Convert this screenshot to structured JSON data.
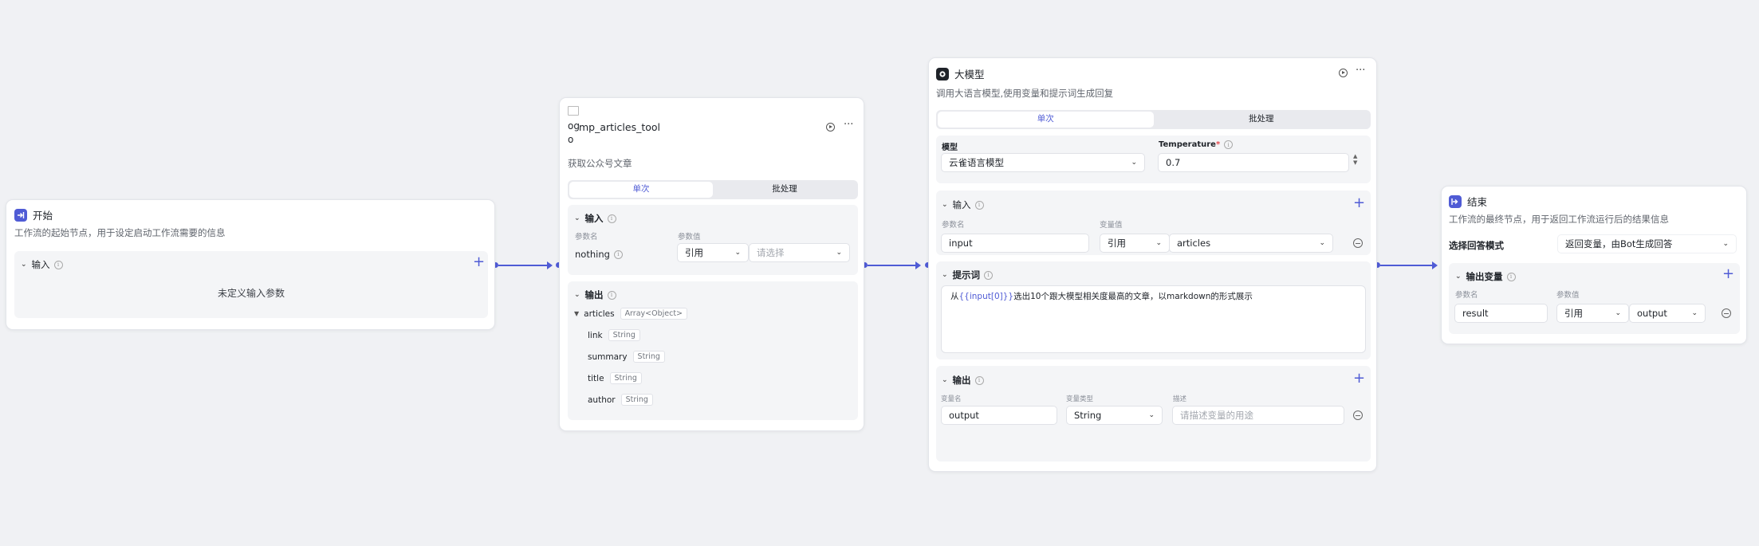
{
  "colors": {
    "accent": "#4f5bd5",
    "start_icon": "#4f5bd5",
    "llm_icon": "#1f2329",
    "end_icon": "#4f5bd5"
  },
  "start_node": {
    "title": "开始",
    "description": "工作流的起始节点，用于设定启动工作流需要的信息",
    "input_section": "输入",
    "empty_text": "未定义输入参数",
    "icon": "enter-icon"
  },
  "tool_node": {
    "broken_image_text": [
      "og",
      "o"
    ],
    "title": "mp_articles_tool",
    "description": "获取公众号文章",
    "tabs": [
      "单次",
      "批处理"
    ],
    "input_section": "输入",
    "param_name_label": "参数名",
    "param_value_label": "参数值",
    "param_name": "nothing",
    "ref_select": "引用",
    "value_placeholder": "请选择",
    "output_section": "输出",
    "outputs": [
      {
        "name": "articles",
        "type": "Array<Object>"
      },
      {
        "name": "link",
        "type": "String"
      },
      {
        "name": "summary",
        "type": "String"
      },
      {
        "name": "title",
        "type": "String"
      },
      {
        "name": "author",
        "type": "String"
      }
    ]
  },
  "llm_node": {
    "title": "大模型",
    "description": "调用大语言模型,使用变量和提示词生成回复",
    "tabs": [
      "单次",
      "批处理"
    ],
    "model_label": "模型",
    "model_value": "云雀语言模型",
    "temperature_label": "Temperature",
    "temperature_required": "*",
    "temperature_value": "0.7",
    "input_section": "输入",
    "param_name_label": "参数名",
    "var_value_label": "变量值",
    "input_name": "input",
    "ref_select": "引用",
    "ref_value": "articles",
    "prompt_section": "提示词",
    "prompt_prefix": "从",
    "prompt_var": "{{input[0]}}",
    "prompt_suffix": "选出10个跟大模型相关度最高的文章，以markdown的形式展示",
    "output_section": "输出",
    "out_name_label": "变量名",
    "out_type_label": "变量类型",
    "out_desc_label": "描述",
    "output_name": "output",
    "output_type": "String",
    "output_desc_placeholder": "请描述变量的用途"
  },
  "end_node": {
    "title": "结束",
    "description": "工作流的最终节点，用于返回工作流运行后的结果信息",
    "answer_mode_label": "选择回答模式",
    "answer_mode_value": "返回变量，由Bot生成回答",
    "output_var_section": "输出变量",
    "param_name_label": "参数名",
    "param_value_label": "参数值",
    "param_name": "result",
    "ref_select": "引用",
    "ref_value": "output"
  }
}
